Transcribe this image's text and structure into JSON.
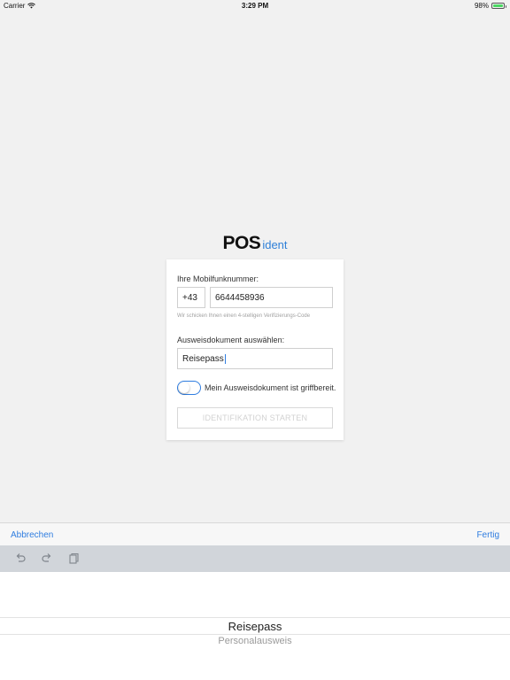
{
  "status_bar": {
    "carrier": "Carrier",
    "time": "3:29 PM",
    "battery": "98%",
    "battery_level": 0.98
  },
  "brand": {
    "name_bold": "POS",
    "name_accent": "ident",
    "accent_color": "#2f80d8"
  },
  "form": {
    "phone_label": "Ihre Mobilfunknummer:",
    "country_code": "+43",
    "phone_number": "6644458936",
    "phone_hint": "Wir schicken Ihnen einen 4-stelligen Verifizierungs-Code",
    "document_label": "Ausweisdokument auswählen:",
    "document_value": "Reisepass",
    "toggle_label": "Mein Ausweisdokument ist griffbereit.",
    "toggle_on": false,
    "start_button": "IDENTIFIKATION STARTEN"
  },
  "picker_toolbar": {
    "cancel": "Abbrechen",
    "done": "Fertig"
  },
  "shortcut_bar": {
    "icons": [
      "undo-icon",
      "redo-icon",
      "paste-icon"
    ]
  },
  "picker": {
    "options": [
      "Reisepass",
      "Personalausweis"
    ],
    "selected": "Reisepass"
  }
}
